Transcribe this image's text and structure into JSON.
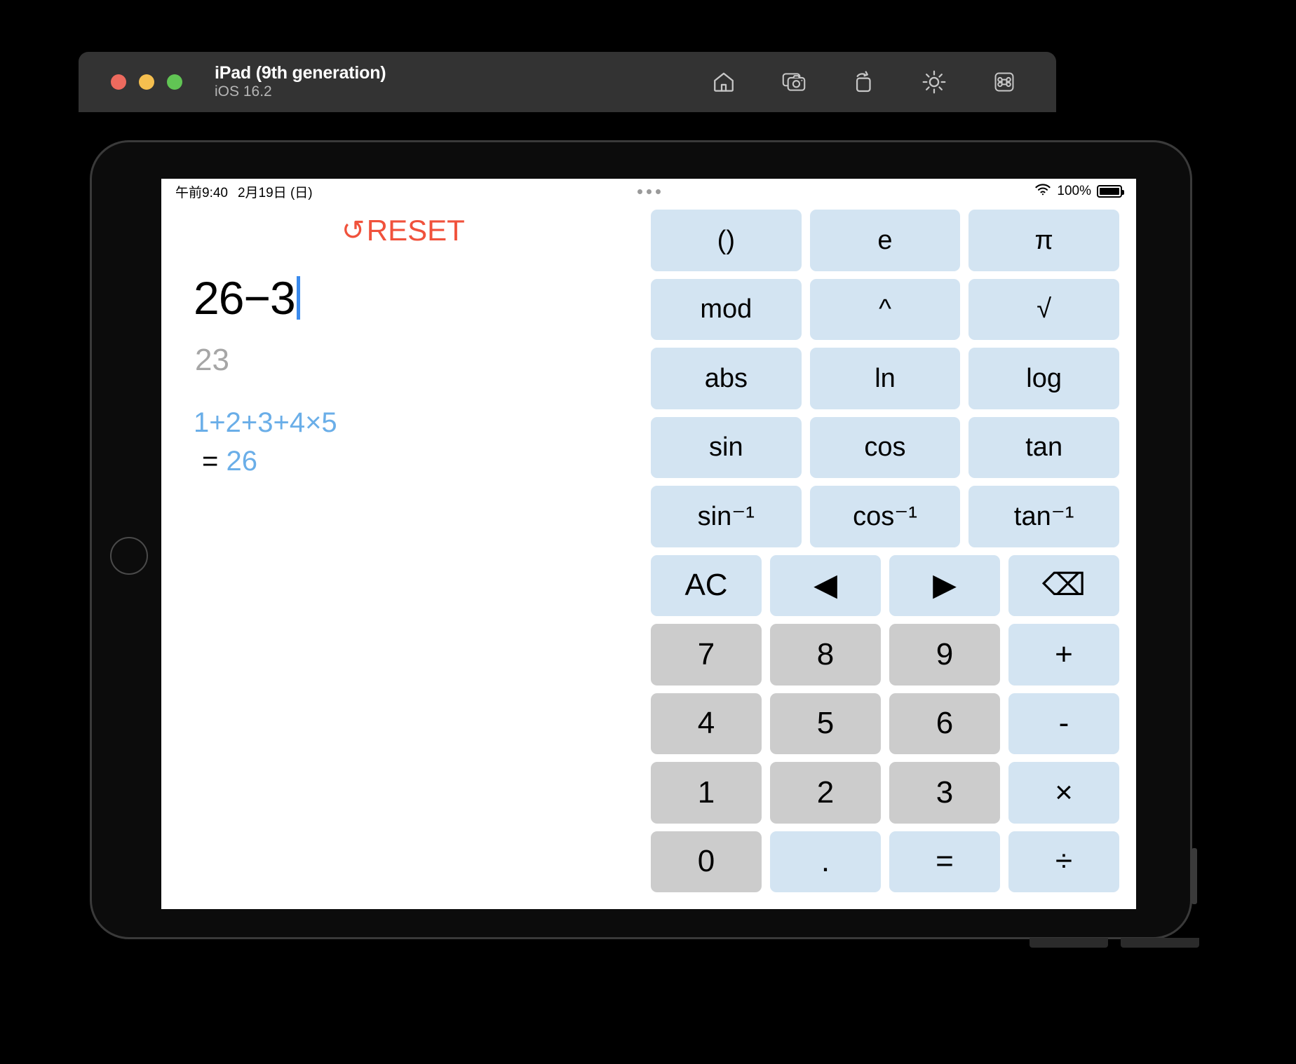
{
  "simulator": {
    "title": "iPad (9th generation)",
    "subtitle": "iOS 16.2",
    "window_controls": [
      "close",
      "minimize",
      "zoom"
    ],
    "toolbar_icons": [
      "home-icon",
      "screenshot-icon",
      "rotate-icon",
      "brightness-icon",
      "keyboard-shortcut-icon"
    ]
  },
  "status_bar": {
    "time": "午前9:40",
    "date": "2月19日 (日)",
    "battery_percent": "100%",
    "wifi_icon": "wifi-icon",
    "battery_icon": "battery-full-icon",
    "multitask_icon": "multitask-dots-icon"
  },
  "calculator": {
    "reset_label": "RESET",
    "reset_icon": "↻",
    "reset_color": "#f0523c",
    "expression": "26−3",
    "preview_result": "23",
    "preview_color": "#a6a6a6",
    "caret_color": "#3b8bed",
    "history": [
      {
        "expression": "1+2+3+4×5",
        "equals": "=",
        "result": "26"
      }
    ],
    "history_color": "#6aaee8",
    "colors": {
      "function_key": "#d3e4f2",
      "number_key": "#cccccc",
      "screen": "#ffffff"
    },
    "keys": [
      {
        "label": "()",
        "name": "key-parentheses",
        "type": "function",
        "span": 4
      },
      {
        "label": "e",
        "name": "key-e",
        "type": "function",
        "span": 4
      },
      {
        "label": "π",
        "name": "key-pi",
        "type": "function",
        "span": 4
      },
      {
        "label": "mod",
        "name": "key-mod",
        "type": "function",
        "span": 4
      },
      {
        "label": "^",
        "name": "key-power",
        "type": "function",
        "span": 4
      },
      {
        "label": "√",
        "name": "key-sqrt",
        "type": "function",
        "span": 4
      },
      {
        "label": "abs",
        "name": "key-abs",
        "type": "function",
        "span": 4
      },
      {
        "label": "ln",
        "name": "key-ln",
        "type": "function",
        "span": 4
      },
      {
        "label": "log",
        "name": "key-log",
        "type": "function",
        "span": 4
      },
      {
        "label": "sin",
        "name": "key-sin",
        "type": "function",
        "span": 4
      },
      {
        "label": "cos",
        "name": "key-cos",
        "type": "function",
        "span": 4
      },
      {
        "label": "tan",
        "name": "key-tan",
        "type": "function",
        "span": 4
      },
      {
        "label": "sin⁻¹",
        "name": "key-arcsin",
        "type": "function",
        "span": 4
      },
      {
        "label": "cos⁻¹",
        "name": "key-arccos",
        "type": "function",
        "span": 4
      },
      {
        "label": "tan⁻¹",
        "name": "key-arctan",
        "type": "function",
        "span": 4
      },
      {
        "label": "AC",
        "name": "key-all-clear",
        "type": "function",
        "span": 3
      },
      {
        "label": "◀",
        "name": "key-cursor-left",
        "type": "function",
        "span": 3
      },
      {
        "label": "▶",
        "name": "key-cursor-right",
        "type": "function",
        "span": 3
      },
      {
        "label": "⌫",
        "name": "key-backspace",
        "type": "function",
        "span": 3
      },
      {
        "label": "7",
        "name": "key-7",
        "type": "number",
        "span": 3
      },
      {
        "label": "8",
        "name": "key-8",
        "type": "number",
        "span": 3
      },
      {
        "label": "9",
        "name": "key-9",
        "type": "number",
        "span": 3
      },
      {
        "label": "+",
        "name": "key-plus",
        "type": "function",
        "span": 3
      },
      {
        "label": "4",
        "name": "key-4",
        "type": "number",
        "span": 3
      },
      {
        "label": "5",
        "name": "key-5",
        "type": "number",
        "span": 3
      },
      {
        "label": "6",
        "name": "key-6",
        "type": "number",
        "span": 3
      },
      {
        "label": "-",
        "name": "key-minus",
        "type": "function",
        "span": 3
      },
      {
        "label": "1",
        "name": "key-1",
        "type": "number",
        "span": 3
      },
      {
        "label": "2",
        "name": "key-2",
        "type": "number",
        "span": 3
      },
      {
        "label": "3",
        "name": "key-3",
        "type": "number",
        "span": 3
      },
      {
        "label": "×",
        "name": "key-multiply",
        "type": "function",
        "span": 3
      },
      {
        "label": "0",
        "name": "key-0",
        "type": "number",
        "span": 3
      },
      {
        "label": ".",
        "name": "key-decimal",
        "type": "function",
        "span": 3
      },
      {
        "label": "=",
        "name": "key-equals",
        "type": "function",
        "span": 3
      },
      {
        "label": "÷",
        "name": "key-divide",
        "type": "function",
        "span": 3
      }
    ]
  }
}
